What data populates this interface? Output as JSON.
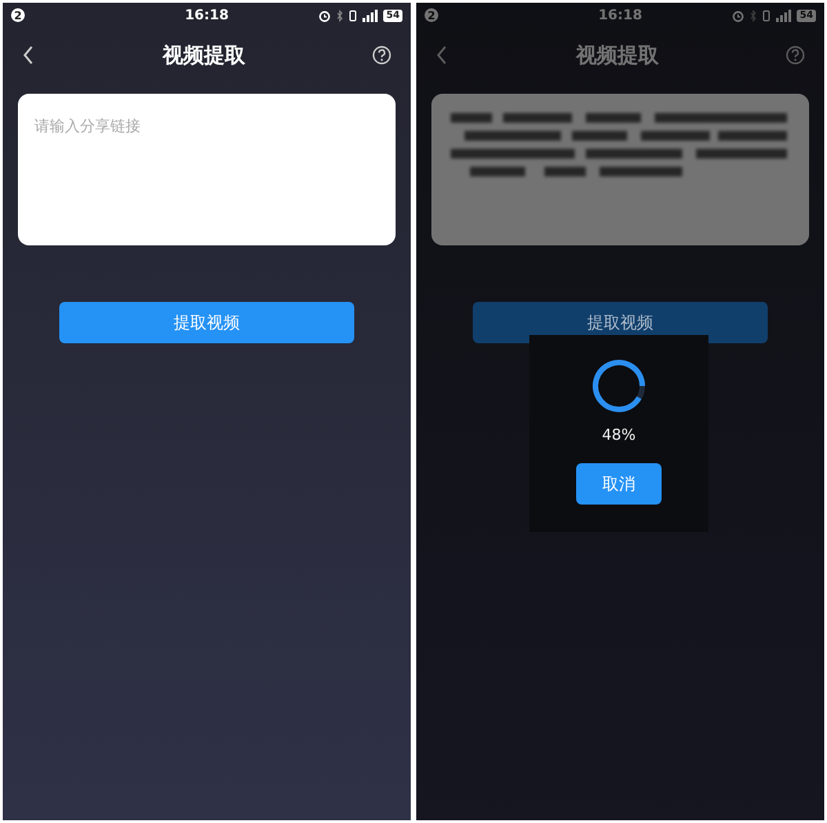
{
  "screens": [
    {
      "status_bar": {
        "notification_count": "2",
        "time": "16:18",
        "battery": "54"
      },
      "title": "视频提取",
      "link_field": {
        "kind": "empty",
        "placeholder": "请输入分享链接"
      },
      "extract_button": "提取视频",
      "dimmed": false
    },
    {
      "status_bar": {
        "notification_count": "2",
        "time": "16:18",
        "battery": "54"
      },
      "title": "视频提取",
      "link_field": {
        "kind": "redacted"
      },
      "extract_button": "提取视频",
      "dimmed": true,
      "loading_dialog": {
        "progress": "48%",
        "cancel_button": "取消"
      }
    }
  ]
}
